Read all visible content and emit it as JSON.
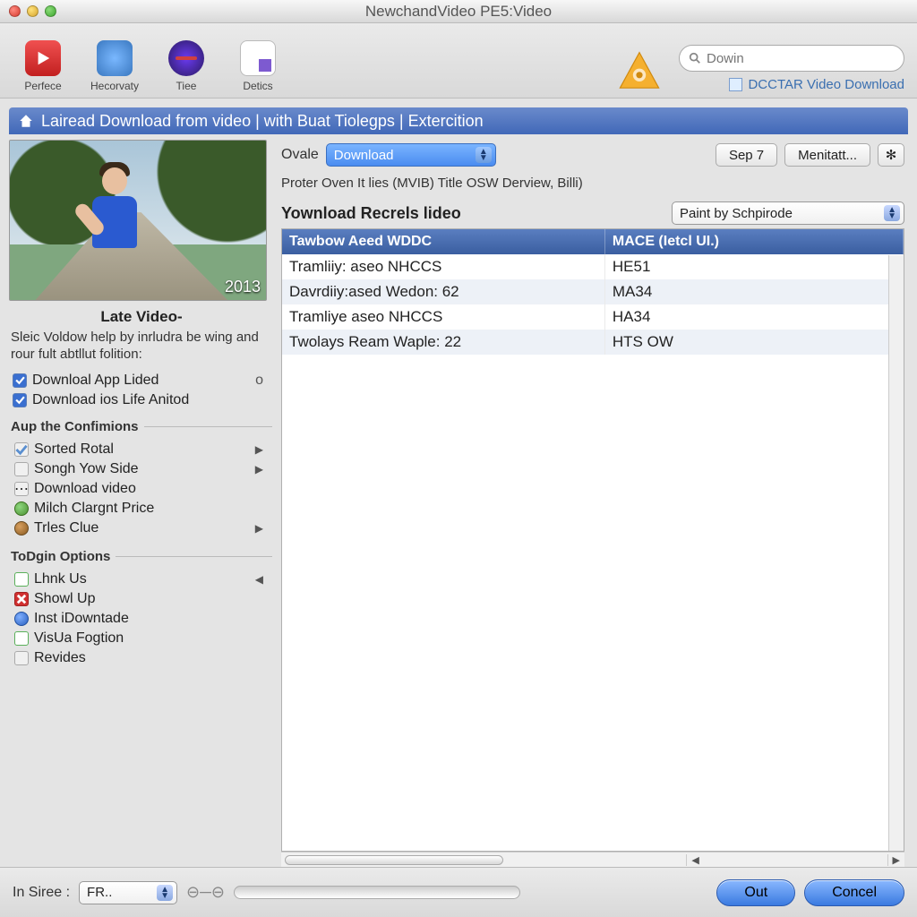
{
  "window": {
    "title": "NewchandVideo PE5:Video"
  },
  "toolbar": {
    "buttons": [
      {
        "label": "Perfece"
      },
      {
        "label": "Hecorvaty"
      },
      {
        "label": "Tiee"
      },
      {
        "label": "Detics"
      }
    ],
    "search_placeholder": "Dowin",
    "download_link": "DCCTAR Video Download"
  },
  "bluebar": "Lairead Download from video | with Buat Tiolegps | Extercition",
  "left": {
    "thumb_year": "2013",
    "title": "Late Video-",
    "desc": "Sleic Voldow help by inrludra be wing and rour fult abtllut folition:",
    "checks": [
      {
        "label": "Downloal App Lided",
        "seg": "o"
      },
      {
        "label": "Download ios Life Anitod"
      }
    ],
    "group1_title": "Aup the Confimions",
    "group1_items": [
      {
        "label": "Sorted Rotal",
        "tri": true,
        "kind": "grey",
        "check": true
      },
      {
        "label": "Songh Yow Side",
        "tri": true,
        "kind": "grey"
      },
      {
        "label": "Download video",
        "kind": "grey"
      },
      {
        "label": "Milch Clargnt Price",
        "kind": "ball"
      },
      {
        "label": "Trles Clue",
        "tri": true,
        "kind": "brown"
      }
    ],
    "group2_title": "ToDgin Options",
    "group2_items": [
      {
        "label": "Lhnk Us",
        "tri_left": true,
        "kind": "green",
        "check": true
      },
      {
        "label": "Showl Up",
        "kind": "red",
        "x": true
      },
      {
        "label": "Inst iDowntade",
        "kind": "bluec"
      },
      {
        "label": "VisUa Fogtion",
        "kind": "green",
        "check": true
      },
      {
        "label": "Revides",
        "kind": "grey"
      }
    ]
  },
  "main": {
    "ovale_label": "Ovale",
    "ovale_value": "Download",
    "date_btn": "Sep 7",
    "menitatt_btn": "Menitatt...",
    "subhdr": "Proter Oven It lies (MVIB) Title     OSW Derview, Billi)",
    "table_title": "Yownload Recrels lideo",
    "paint_combo": "Paint by Schpirode",
    "cols": [
      "Tawbow Aeed WDDC",
      "MACE (Ietcl UI.)"
    ],
    "rows": [
      {
        "c1": "Tramliiy: aseo NHCCS",
        "c2": "HE51"
      },
      {
        "c1": "Davrdiiy:ased Wedon: 62",
        "c2": "MA34"
      },
      {
        "c1": "Tramliye aseo NHCCS",
        "c2": "HA34"
      },
      {
        "c1": "Twolays Ream Waple: 22",
        "c2": "HTS OW"
      }
    ]
  },
  "footer": {
    "in_siree": "In Siree :",
    "fr": "FR..",
    "out": "Out",
    "cancel": "Concel"
  }
}
